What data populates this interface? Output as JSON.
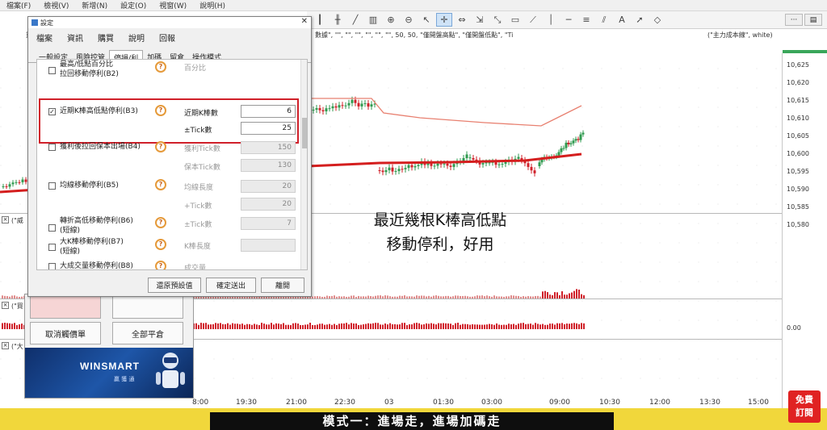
{
  "menubar": {
    "items": [
      "檔案(F)",
      "檢視(V)",
      "新增(N)",
      "設定(O)",
      "視窗(W)",
      "說明(H)"
    ]
  },
  "chart": {
    "study_header": "數據\", \"\", \"\", \"\", \"\", \"\", \"\", 50, 50, \"僅開盤高點\", \"僅開盤低點\", \"Ti",
    "indicator_header": "(\"主力成本線\", white)",
    "left_header": "重疊",
    "price_labels": [
      "10,625",
      "10,620",
      "10,615",
      "10,610",
      "10,605",
      "10,600",
      "10,595",
      "10,590",
      "10,585",
      "10,580"
    ],
    "zero_label": "0.00",
    "time_labels": [
      "8:00",
      "19:30",
      "21:00",
      "22:30",
      "03",
      "01:30",
      "03:00",
      "09:00",
      "10:30",
      "12:00",
      "13:30",
      "15:00"
    ],
    "pane_labels": [
      "(\"威",
      "(\"買",
      "(\"大"
    ]
  },
  "annotation": {
    "line1": "最近幾根K棒高低點",
    "line2": "移動停利，好用"
  },
  "trade_panel": {
    "cancel_orders": "取消觸價單",
    "close_all": "全部平倉",
    "brand": "WINSMART",
    "brand_sub": "贏  獲  通"
  },
  "dialog": {
    "title": "設定",
    "menu_tabs": [
      "檔案",
      "資訊",
      "購買",
      "說明",
      "回報"
    ],
    "sub_tabs": [
      "一般設定",
      "風險控管",
      "停損/利",
      "加碼",
      "留倉",
      "操作模式"
    ],
    "active_sub_tab": "停損/利",
    "rows": {
      "b2_label": "最高/低點百分比\n拉回移動停利(B2)",
      "b2_param": "百分比",
      "b3_label": "近期K棒高低點停利(B3)",
      "b3_param1": "近期K棒數",
      "b3_value1": "6",
      "b3_param2": "±Tick數",
      "b3_value2": "25",
      "b4_label": "獲利後拉回保本出場(B4)",
      "b4_param1": "獲利Tick數",
      "b4_value1": "150",
      "b4_param2": "保本Tick數",
      "b4_value2": "130",
      "b5_label": "均線移動停利(B5)",
      "b5_param1": "均線長度",
      "b5_value1": "20",
      "b5_param2": "+Tick數",
      "b5_value2": "20",
      "b6_label": "轉折高低移動停利(B6)\n(短線)",
      "b6_param": "±Tick數",
      "b6_value": "7",
      "b7_label": "大K棒移動停利(B7)\n(短線)",
      "b7_param": "K棒長度",
      "b8_label": "大成交量移動停利(B8)",
      "b8_param": "成交量"
    },
    "buttons": {
      "restore": "還原預設值",
      "confirm": "確定送出",
      "close": "離開"
    }
  },
  "footer": {
    "title": "模式一：進場走，進場加碼走",
    "subscribe": "免費\n訂閱"
  },
  "colors": {
    "highlight_border": "#d0202a",
    "banner_yellow": "#f1d73b",
    "candle_up": "#2f9a4f",
    "candle_down": "#d0202a",
    "ma_line": "#d41e1e"
  }
}
